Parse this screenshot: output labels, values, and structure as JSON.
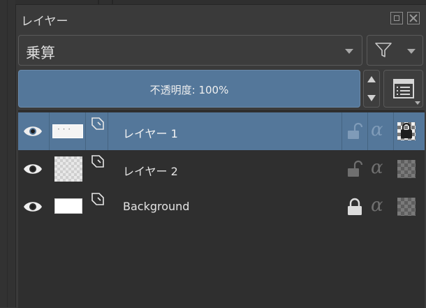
{
  "docker": {
    "title": "レイヤー",
    "float_icon": "float-icon",
    "close_icon": "close-icon"
  },
  "blend_mode": {
    "value": "乗算",
    "icon": "chevron-down-icon"
  },
  "filter": {
    "icon": "filter-icon"
  },
  "opacity": {
    "label": "不透明度: 100%",
    "value_percent": 100
  },
  "layers": [
    {
      "name": "レイヤー 1",
      "selected": true,
      "visible": true,
      "locked": false,
      "thumbnail": "mostly-white"
    },
    {
      "name": "レイヤー 2",
      "selected": false,
      "visible": true,
      "locked": false,
      "thumbnail": "transparent"
    },
    {
      "name": "Background",
      "selected": false,
      "visible": true,
      "locked": true,
      "thumbnail": "white"
    }
  ],
  "colors": {
    "selection": "#54779a",
    "panel": "#3a3a3a",
    "list_bg": "#2f2f2f"
  }
}
